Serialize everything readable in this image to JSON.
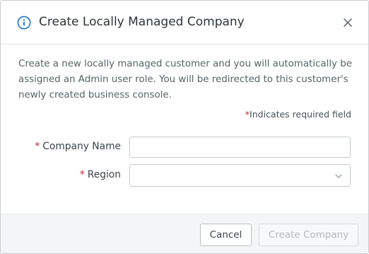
{
  "dialog": {
    "title": "Create Locally Managed Company",
    "description": "Create a new locally managed customer and you will automatically be assigned an Admin user role. You will be redirected to this customer's newly created business console.",
    "required_star": "*",
    "required_note": "Indicates required field"
  },
  "form": {
    "company_name": {
      "star": "*",
      "label": "Company Name",
      "value": "",
      "placeholder": ""
    },
    "region": {
      "star": "*",
      "label": "Region",
      "selected": ""
    }
  },
  "footer": {
    "cancel_label": "Cancel",
    "create_label": "Create Company"
  },
  "icons": {
    "info": "info-icon",
    "close": "close-icon",
    "chevron": "chevron-down-icon"
  },
  "colors": {
    "accent": "#1a73c4",
    "required": "#c0262d",
    "disabled_text": "#b3b8bd"
  }
}
